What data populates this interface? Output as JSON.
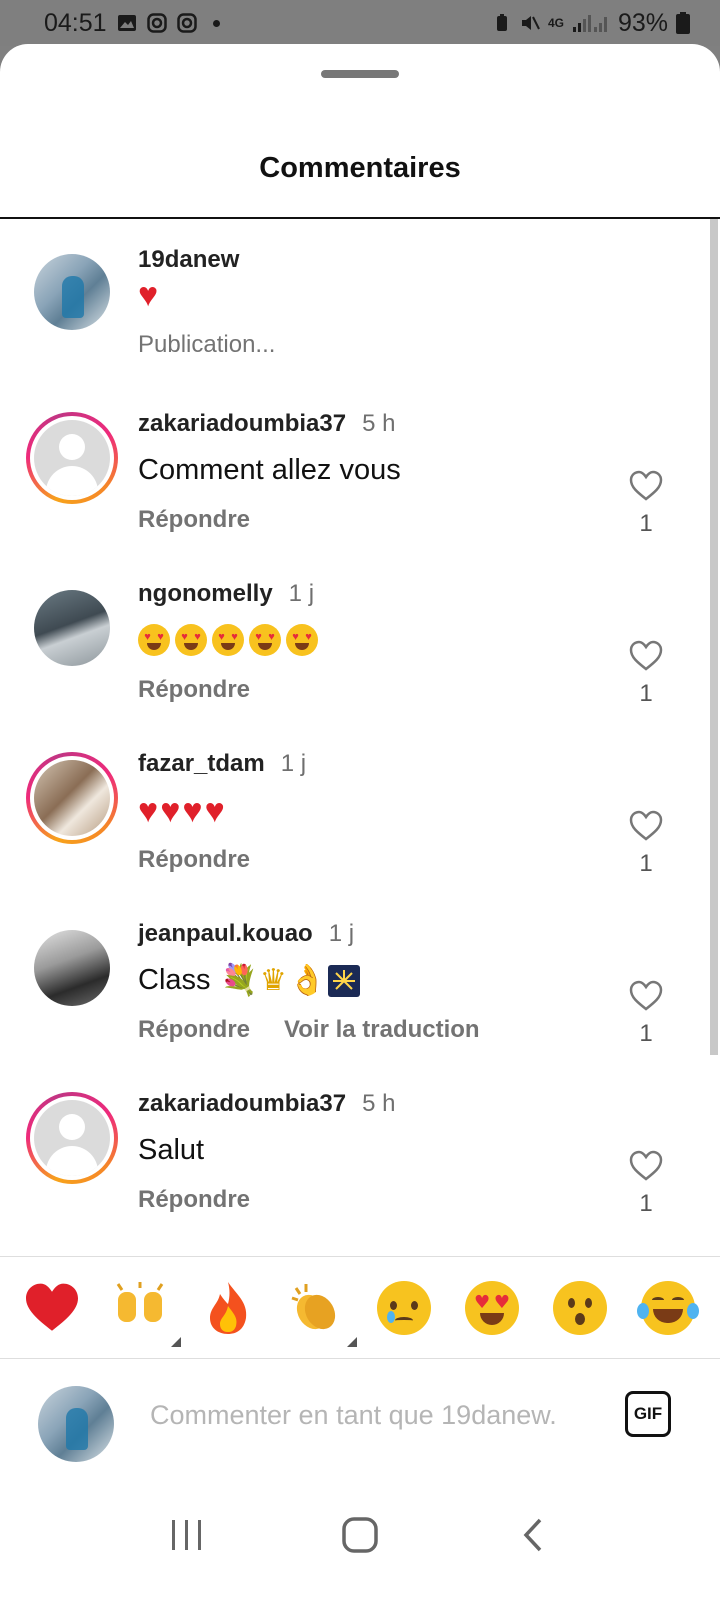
{
  "status_bar": {
    "time": "04:51",
    "network": "4G",
    "battery": "93%"
  },
  "sheet": {
    "title": "Commentaires"
  },
  "comments": [
    {
      "username": "19danew",
      "time": "",
      "text": "",
      "content_emojis": [
        "heart"
      ],
      "subtext": "Publication...",
      "avatar": "photo",
      "has_like": false
    },
    {
      "username": "zakariadoumbia37",
      "time": "5 h",
      "text": "Comment allez vous",
      "reply": "Répondre",
      "likes": "1",
      "avatar": "default-with-story-ring"
    },
    {
      "username": "ngonomelly",
      "time": "1 j",
      "text": "",
      "content_emojis": [
        "heart-eyes",
        "heart-eyes",
        "heart-eyes",
        "heart-eyes",
        "heart-eyes"
      ],
      "reply": "Répondre",
      "likes": "1",
      "avatar": "photo"
    },
    {
      "username": "fazar_tdam",
      "time": "1 j",
      "text": "",
      "content_emojis": [
        "heart",
        "heart",
        "heart",
        "heart"
      ],
      "reply": "Répondre",
      "likes": "1",
      "avatar": "photo-with-story-ring"
    },
    {
      "username": "jeanpaul.kouao",
      "time": "1 j",
      "text": "Class",
      "content_emojis": [
        "bouquet",
        "crown",
        "ok-hand",
        "fireworks"
      ],
      "reply": "Répondre",
      "translate": "Voir la traduction",
      "likes": "1",
      "avatar": "photo"
    },
    {
      "username": "zakariadoumbia37",
      "time": "5 h",
      "text": "Salut",
      "reply": "Répondre",
      "likes": "1",
      "avatar": "default-with-story-ring"
    }
  ],
  "quick_reactions": [
    "red-heart",
    "raising-hands",
    "fire",
    "clapping-hands",
    "crying-face",
    "heart-eyes",
    "surprised-face",
    "tears-of-joy"
  ],
  "composer": {
    "placeholder": "Commenter en tant que 19danew.",
    "gif_label": "GIF"
  },
  "colors": {
    "story_ring_start": "#f7a21b",
    "story_ring_end": "#c13584",
    "heart_red": "#e0202a"
  }
}
